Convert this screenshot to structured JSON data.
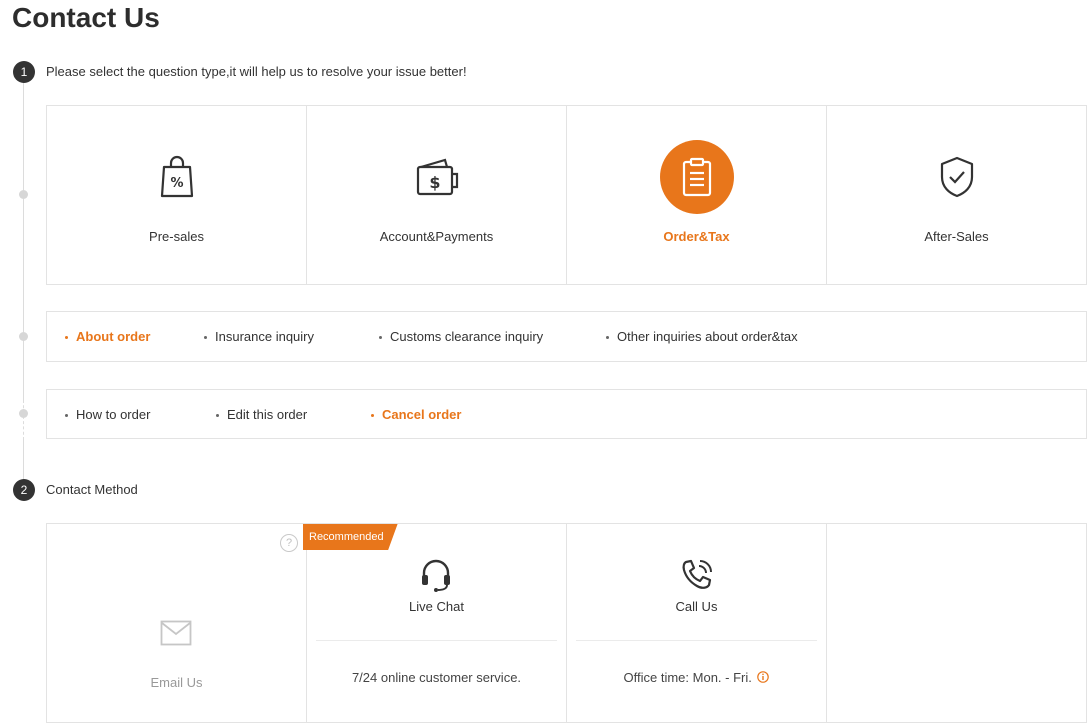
{
  "page": {
    "title": "Contact Us"
  },
  "steps": [
    {
      "number": "1",
      "label": "Please select the question type,it will help us to resolve your issue better!"
    },
    {
      "number": "2",
      "label": "Contact Method"
    }
  ],
  "question_types": [
    {
      "label": "Pre-sales",
      "icon": "shopping-bag-percent-icon",
      "active": false
    },
    {
      "label": "Account&Payments",
      "icon": "wallet-icon",
      "active": false
    },
    {
      "label": "Order&Tax",
      "icon": "clipboard-icon",
      "active": true
    },
    {
      "label": "After-Sales",
      "icon": "shield-check-icon",
      "active": false
    }
  ],
  "order_tax_topics": [
    {
      "label": "About order",
      "active": true
    },
    {
      "label": "Insurance inquiry",
      "active": false
    },
    {
      "label": "Customs clearance inquiry",
      "active": false
    },
    {
      "label": "Other inquiries about order&tax",
      "active": false
    }
  ],
  "about_order_topics": [
    {
      "label": "How to order",
      "active": false
    },
    {
      "label": "Edit this order",
      "active": false
    },
    {
      "label": "Cancel order",
      "active": true
    }
  ],
  "contact_methods": {
    "email": {
      "label": "Email Us",
      "help": "?",
      "icon": "envelope-icon"
    },
    "live_chat": {
      "label": "Live Chat",
      "badge": "Recommended",
      "description": "7/24 online customer service.",
      "icon": "headset-icon"
    },
    "call": {
      "label": "Call Us",
      "description": "Office time: Mon. - Fri.",
      "icon": "phone-icon",
      "info_icon": "info-icon"
    }
  },
  "colors": {
    "accent": "#e8761b",
    "text": "#333333",
    "border": "#e3e3e3"
  }
}
